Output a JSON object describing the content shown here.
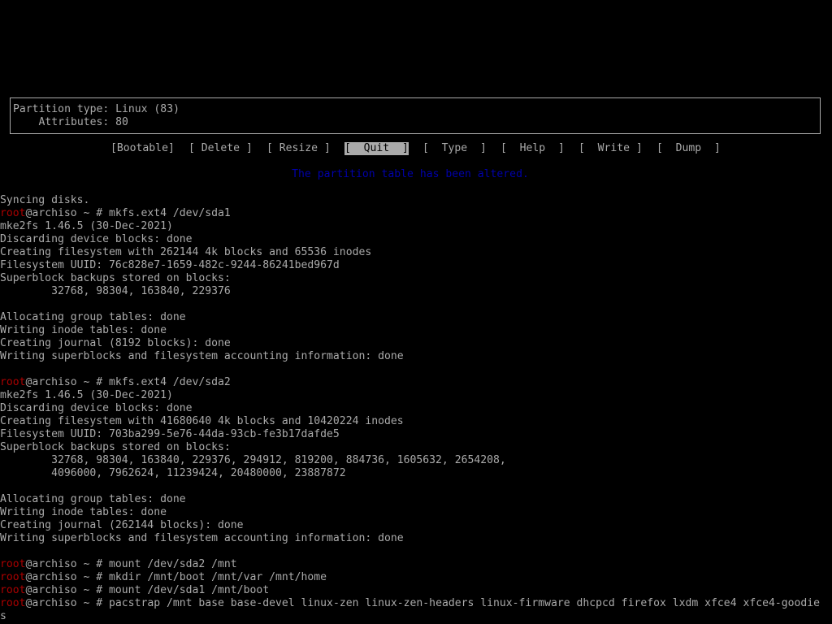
{
  "info": {
    "partition_type": "Partition type: Linux (83)",
    "attributes": "    Attributes: 80"
  },
  "menu": [
    {
      "label": "[Bootable]",
      "selected": false
    },
    {
      "label": "[ Delete ]",
      "selected": false
    },
    {
      "label": "[ Resize ]",
      "selected": false
    },
    {
      "label": "[  Quit  ]",
      "selected": true
    },
    {
      "label": "[  Type  ]",
      "selected": false
    },
    {
      "label": "[  Help  ]",
      "selected": false
    },
    {
      "label": "[  Write ]",
      "selected": false
    },
    {
      "label": "[  Dump  ]",
      "selected": false
    }
  ],
  "status_message": "The partition table has been altered.",
  "colors": {
    "background": "#000000",
    "text": "#aaaaaa",
    "prompt_user": "#aa0000",
    "status": "#0000aa"
  },
  "terminal": {
    "user": "root",
    "host_prompt": "@archiso ~ # ",
    "lines": [
      {
        "text": "Syncing disks."
      },
      {
        "prompt": true,
        "cmd": "mkfs.ext4 /dev/sda1"
      },
      {
        "text": "mke2fs 1.46.5 (30-Dec-2021)"
      },
      {
        "text": "Discarding device blocks: done"
      },
      {
        "text": "Creating filesystem with 262144 4k blocks and 65536 inodes"
      },
      {
        "text": "Filesystem UUID: 76c828e7-1659-482c-9244-86241bed967d"
      },
      {
        "text": "Superblock backups stored on blocks:"
      },
      {
        "text": "        32768, 98304, 163840, 229376"
      },
      {
        "text": ""
      },
      {
        "text": "Allocating group tables: done"
      },
      {
        "text": "Writing inode tables: done"
      },
      {
        "text": "Creating journal (8192 blocks): done"
      },
      {
        "text": "Writing superblocks and filesystem accounting information: done"
      },
      {
        "text": ""
      },
      {
        "prompt": true,
        "cmd": "mkfs.ext4 /dev/sda2"
      },
      {
        "text": "mke2fs 1.46.5 (30-Dec-2021)"
      },
      {
        "text": "Discarding device blocks: done"
      },
      {
        "text": "Creating filesystem with 41680640 4k blocks and 10420224 inodes"
      },
      {
        "text": "Filesystem UUID: 703ba299-5e76-44da-93cb-fe3b17dafde5"
      },
      {
        "text": "Superblock backups stored on blocks:"
      },
      {
        "text": "        32768, 98304, 163840, 229376, 294912, 819200, 884736, 1605632, 2654208,"
      },
      {
        "text": "        4096000, 7962624, 11239424, 20480000, 23887872"
      },
      {
        "text": ""
      },
      {
        "text": "Allocating group tables: done"
      },
      {
        "text": "Writing inode tables: done"
      },
      {
        "text": "Creating journal (262144 blocks): done"
      },
      {
        "text": "Writing superblocks and filesystem accounting information: done"
      },
      {
        "text": ""
      },
      {
        "prompt": true,
        "cmd": "mount /dev/sda2 /mnt"
      },
      {
        "prompt": true,
        "cmd": "mkdir /mnt/boot /mnt/var /mnt/home"
      },
      {
        "prompt": true,
        "cmd": "mount /dev/sda1 /mnt/boot"
      },
      {
        "prompt": true,
        "cmd": "pacstrap /mnt base base-devel linux-zen linux-zen-headers linux-firmware dhcpcd firefox lxdm xfce4 xfce4-goodie"
      },
      {
        "text": "s"
      }
    ]
  }
}
